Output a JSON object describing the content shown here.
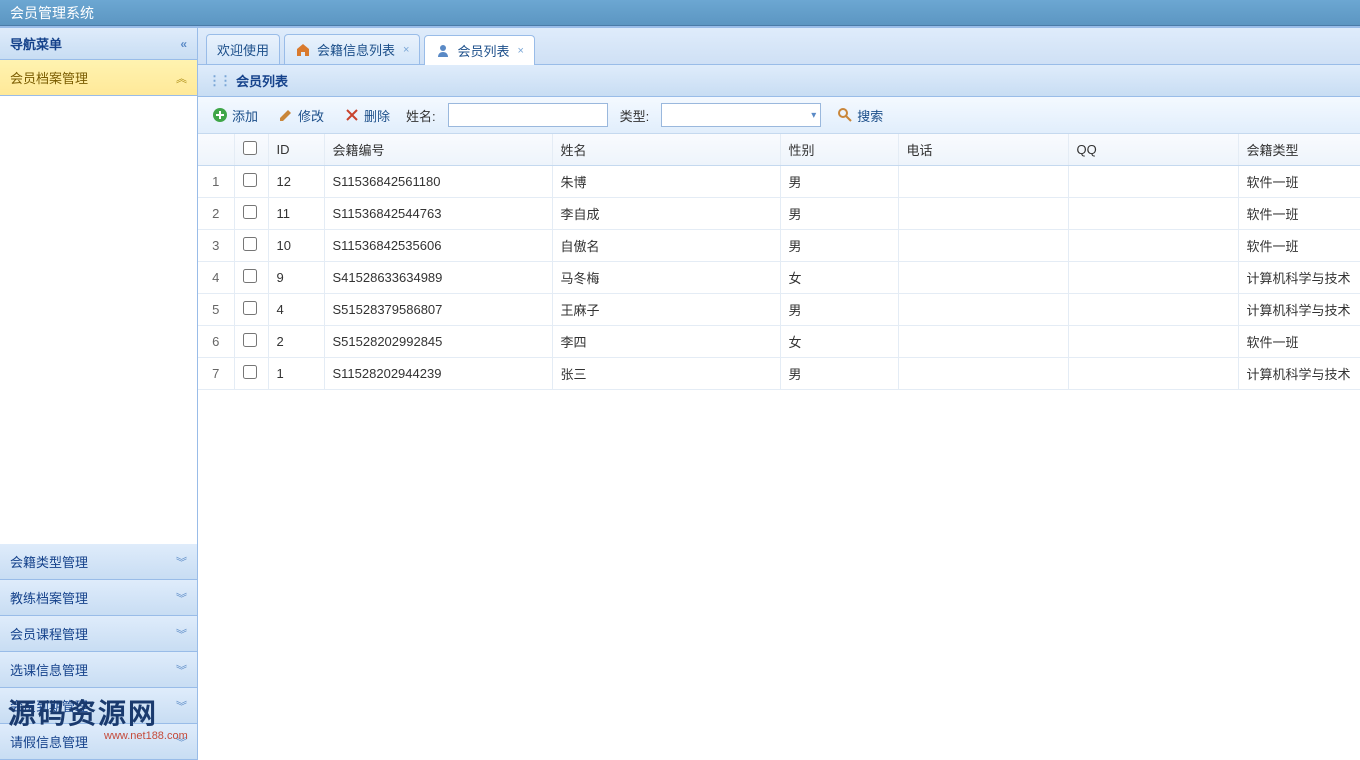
{
  "header": {
    "title": "会员管理系统"
  },
  "sidebar": {
    "title": "导航菜单",
    "items": [
      {
        "label": "会员档案管理",
        "expanded": true
      },
      {
        "label": "会籍类型管理",
        "expanded": false
      },
      {
        "label": "教练档案管理",
        "expanded": false
      },
      {
        "label": "会员课程管理",
        "expanded": false
      },
      {
        "label": "选课信息管理",
        "expanded": false
      },
      {
        "label": "会员到期管理",
        "expanded": false
      },
      {
        "label": "请假信息管理",
        "expanded": false
      }
    ]
  },
  "tabs": [
    {
      "label": "欢迎使用",
      "icon": null,
      "closable": false,
      "active": false
    },
    {
      "label": "会籍信息列表",
      "icon": "home",
      "closable": true,
      "active": false
    },
    {
      "label": "会员列表",
      "icon": "user",
      "closable": true,
      "active": true
    }
  ],
  "panel": {
    "title": "会员列表"
  },
  "toolbar": {
    "add": "添加",
    "edit": "修改",
    "delete": "删除",
    "name_label": "姓名:",
    "name_value": "",
    "type_label": "类型:",
    "type_value": "",
    "search": "搜索"
  },
  "grid": {
    "columns": [
      "ID",
      "会籍编号",
      "姓名",
      "性别",
      "电话",
      "QQ",
      "会籍类型"
    ],
    "rows": [
      {
        "n": "1",
        "id": "12",
        "code": "S11536842561180",
        "name": "朱博",
        "gender": "男",
        "phone": "",
        "qq": "",
        "type": "软件一班"
      },
      {
        "n": "2",
        "id": "11",
        "code": "S11536842544763",
        "name": "李自成",
        "gender": "男",
        "phone": "",
        "qq": "",
        "type": "软件一班"
      },
      {
        "n": "3",
        "id": "10",
        "code": "S11536842535606",
        "name": "自傲名",
        "gender": "男",
        "phone": "",
        "qq": "",
        "type": "软件一班"
      },
      {
        "n": "4",
        "id": "9",
        "code": "S41528633634989",
        "name": "马冬梅",
        "gender": "女",
        "phone": "",
        "qq": "",
        "type": "计算机科学与技术"
      },
      {
        "n": "5",
        "id": "4",
        "code": "S51528379586807",
        "name": "王麻子",
        "gender": "男",
        "phone": "",
        "qq": "",
        "type": "计算机科学与技术"
      },
      {
        "n": "6",
        "id": "2",
        "code": "S51528202992845",
        "name": "李四",
        "gender": "女",
        "phone": "",
        "qq": "",
        "type": "软件一班"
      },
      {
        "n": "7",
        "id": "1",
        "code": "S11528202944239",
        "name": "张三",
        "gender": "男",
        "phone": "",
        "qq": "",
        "type": "计算机科学与技术"
      }
    ]
  },
  "watermark": {
    "main": "源码资源网",
    "sub": "www.net188.com"
  }
}
